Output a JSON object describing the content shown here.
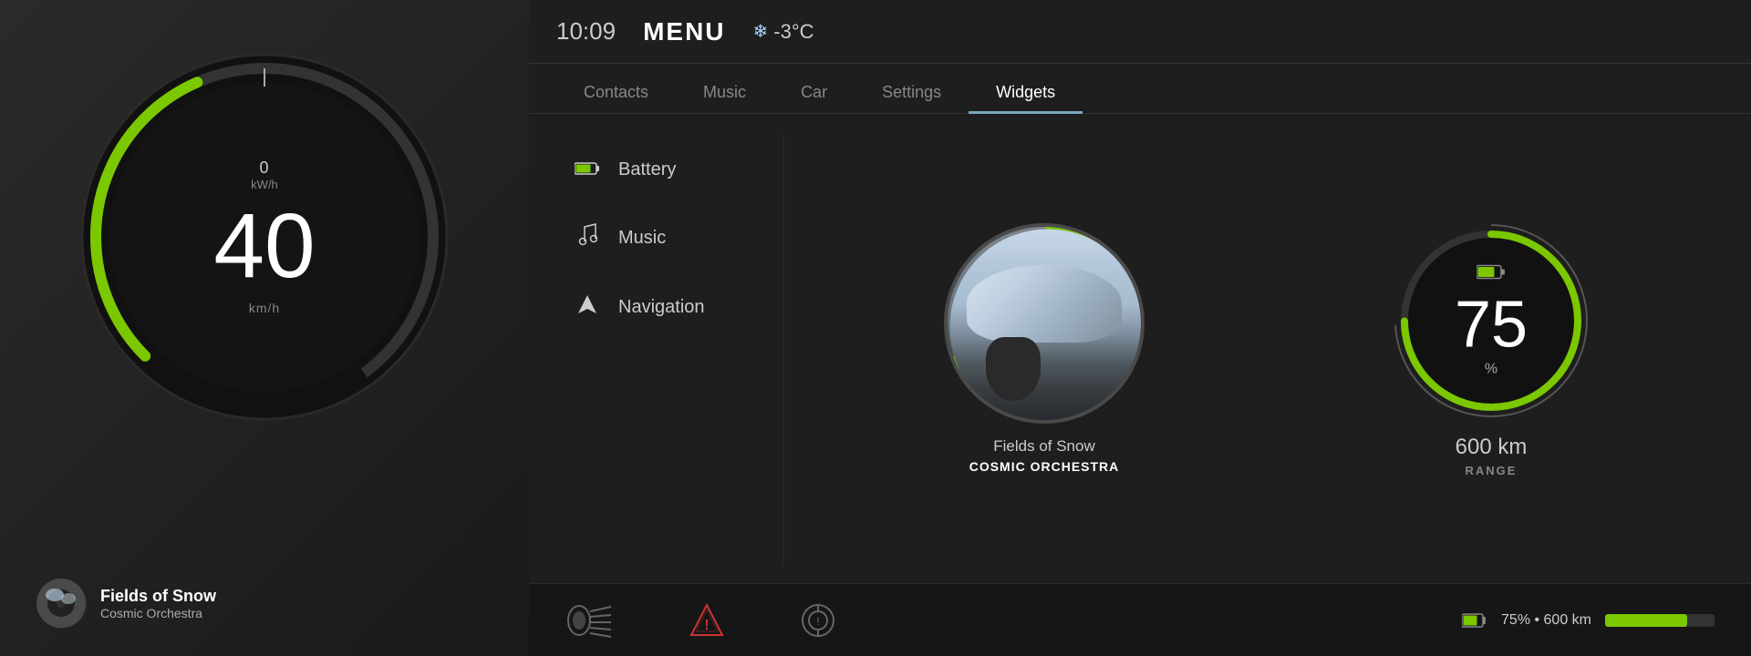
{
  "header": {
    "time": "10:09",
    "menu_label": "MENU",
    "temperature": "-3°C"
  },
  "nav": {
    "tabs": [
      {
        "id": "contacts",
        "label": "Contacts",
        "active": false
      },
      {
        "id": "music",
        "label": "Music",
        "active": false
      },
      {
        "id": "car",
        "label": "Car",
        "active": false
      },
      {
        "id": "settings",
        "label": "Settings",
        "active": false
      },
      {
        "id": "widgets",
        "label": "Widgets",
        "active": true
      }
    ]
  },
  "menu": {
    "items": [
      {
        "id": "battery",
        "label": "Battery",
        "icon": "battery"
      },
      {
        "id": "music",
        "label": "Music",
        "icon": "music-note"
      },
      {
        "id": "navigation",
        "label": "Navigation",
        "icon": "nav-arrow"
      }
    ]
  },
  "speedometer": {
    "speed": "40",
    "speed_unit": "km/h",
    "kwh": "0",
    "kwh_unit": "kW/h"
  },
  "now_playing": {
    "track": "Fields of Snow",
    "artist": "Cosmic Orchestra"
  },
  "music_widget": {
    "track": "Fields of Snow",
    "artist": "COSMIC ORCHESTRA",
    "progress_pct": 30
  },
  "battery_widget": {
    "percentage": "75",
    "pct_symbol": "%",
    "range_value": "600 km",
    "range_label": "RANGE",
    "fill_pct": 75
  },
  "bottom_bar": {
    "battery_text": "75% • 600 km",
    "battery_fill_pct": 75
  },
  "colors": {
    "green": "#7bc700",
    "dark_bg": "#1a1a1a",
    "panel_bg": "#1e1e1e",
    "accent": "#8bc34a"
  }
}
